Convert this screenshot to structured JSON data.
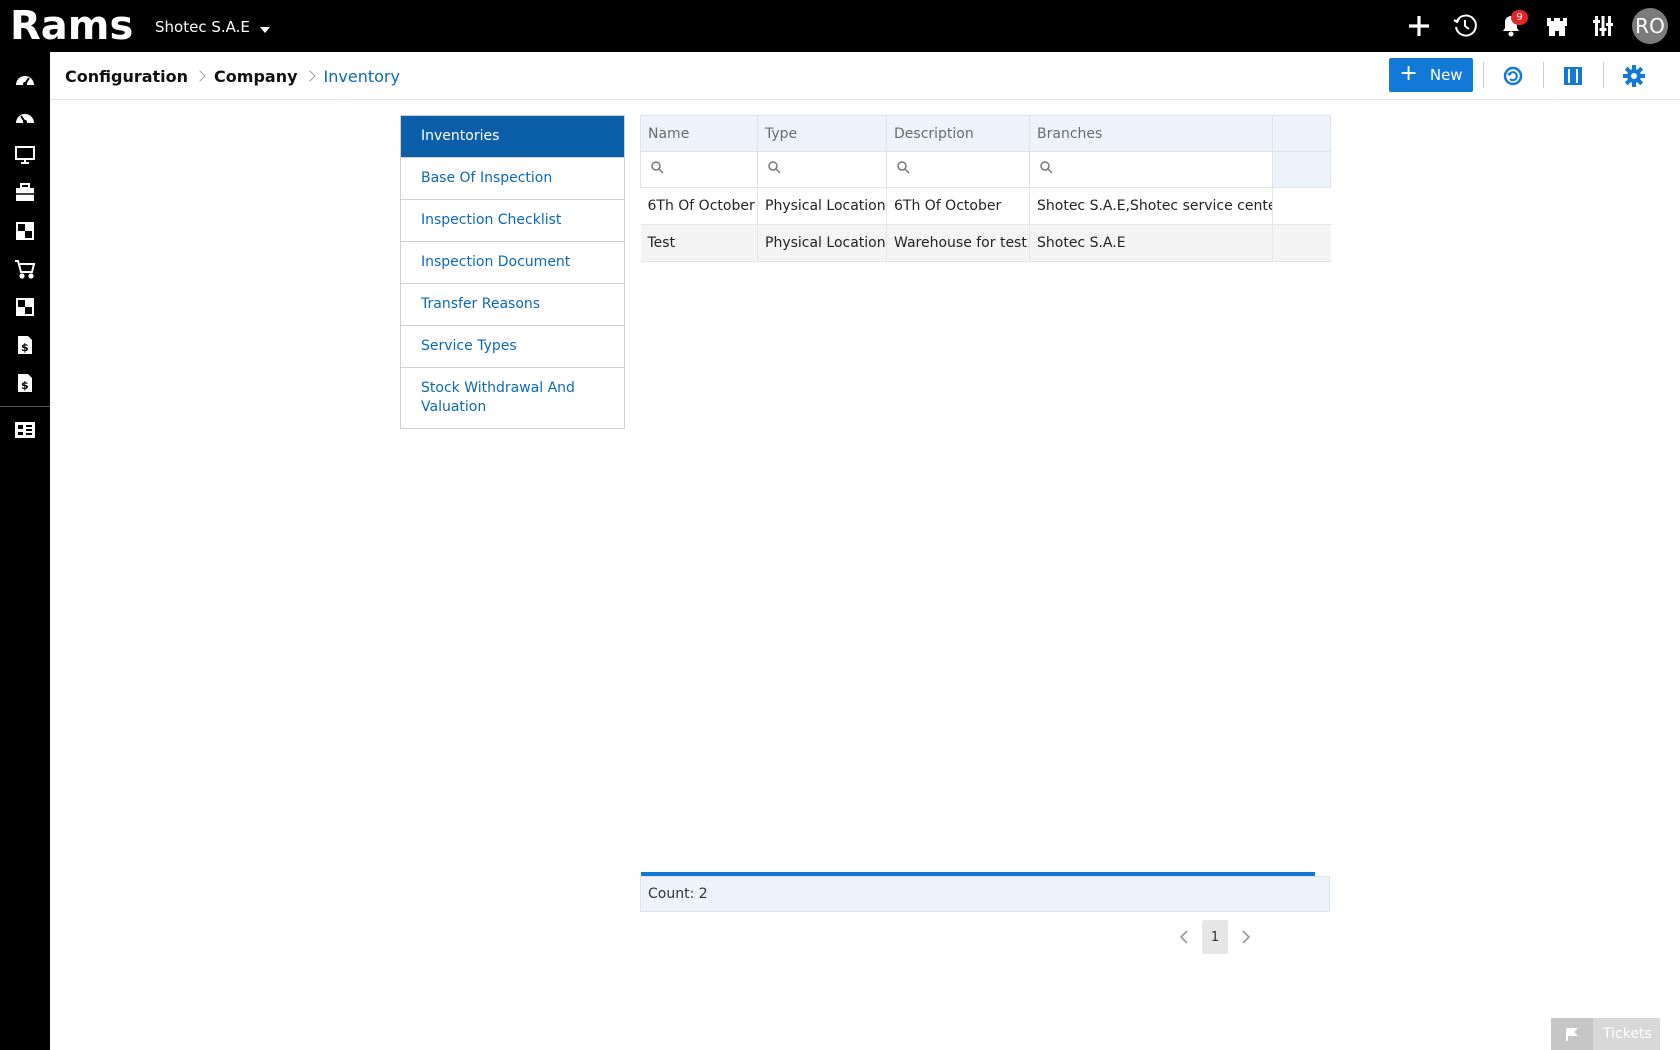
{
  "app": {
    "logo_text": "Rams",
    "company": "Shotec S.A.E",
    "notifications_count": "9",
    "avatar_initials": "RO"
  },
  "breadcrumb": [
    "Configuration",
    "Company",
    "Inventory"
  ],
  "toolbar": {
    "new_label": "New"
  },
  "menu": {
    "items": [
      "Inventories",
      "Base Of Inspection",
      "Inspection Checklist",
      "Inspection Document",
      "Transfer Reasons",
      "Service Types",
      "Stock Withdrawal And Valuation"
    ],
    "active_index": 0
  },
  "grid": {
    "columns": [
      "Name",
      "Type",
      "Description",
      "Branches"
    ],
    "rows": [
      [
        "6Th Of October",
        "Physical Location",
        "6Th Of October",
        "Shotec S.A.E,Shotec service center"
      ],
      [
        "Test",
        "Physical Location",
        "Warehouse for test",
        "Shotec S.A.E"
      ]
    ],
    "count_label": "Count: 2",
    "current_page": "1"
  },
  "tickets": {
    "label": "Tickets"
  },
  "colors": {
    "accent": "#1379d6",
    "menu_active": "#0b5fa8",
    "link": "#0b69b4",
    "badge": "#e3262a"
  }
}
